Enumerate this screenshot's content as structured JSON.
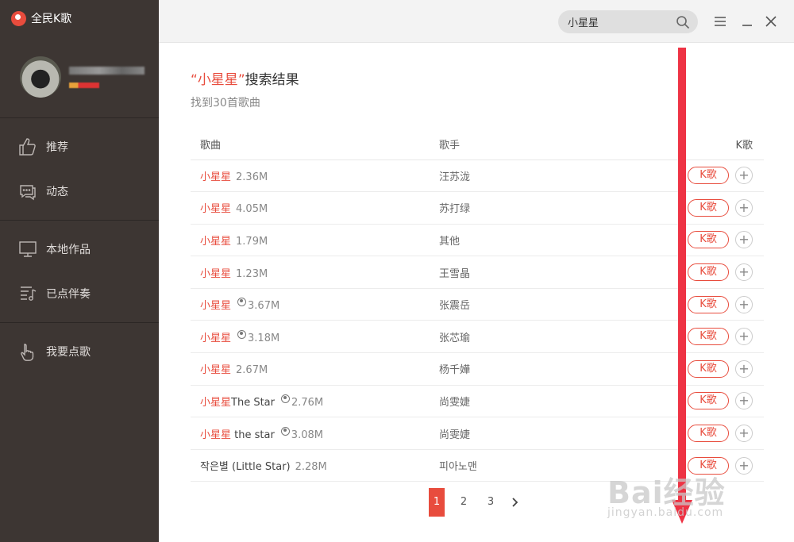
{
  "app": {
    "title": "全民K歌"
  },
  "search": {
    "value": "小星星"
  },
  "result": {
    "title_quote_open": "“",
    "keyword": "小星星",
    "title_quote_close": "”",
    "title_suffix": "搜索结果",
    "subtitle": "找到30首歌曲"
  },
  "nav": [
    {
      "label": "推荐",
      "icon": "thumbs-up-icon"
    },
    {
      "label": "动态",
      "icon": "chat-icon"
    },
    {
      "label": "本地作品",
      "icon": "monitor-icon"
    },
    {
      "label": "已点伴奏",
      "icon": "music-list-icon"
    },
    {
      "label": "我要点歌",
      "icon": "hand-select-icon"
    }
  ],
  "table": {
    "headers": {
      "song": "歌曲",
      "singer": "歌手",
      "k": "K歌"
    },
    "k_label": "K歌",
    "add_label": "+",
    "rows": [
      {
        "name": "小星星",
        "extra": "",
        "globe": false,
        "size": "2.36M",
        "singer": "汪苏泷",
        "plain": false
      },
      {
        "name": "小星星",
        "extra": "",
        "globe": false,
        "size": "4.05M",
        "singer": "苏打绿",
        "plain": false
      },
      {
        "name": "小星星",
        "extra": "",
        "globe": false,
        "size": "1.79M",
        "singer": "其他",
        "plain": false
      },
      {
        "name": "小星星",
        "extra": "",
        "globe": false,
        "size": "1.23M",
        "singer": "王雪晶",
        "plain": false
      },
      {
        "name": "小星星",
        "extra": "",
        "globe": true,
        "size": "3.67M",
        "singer": "张震岳",
        "plain": false
      },
      {
        "name": "小星星",
        "extra": "",
        "globe": true,
        "size": "3.18M",
        "singer": "张芯瑜",
        "plain": false
      },
      {
        "name": "小星星",
        "extra": "",
        "globe": false,
        "size": "2.67M",
        "singer": "杨千嬅",
        "plain": false
      },
      {
        "name": "小星星",
        "extra": "The Star",
        "globe": true,
        "size": "2.76M",
        "singer": "尚雯婕",
        "plain": false
      },
      {
        "name": "小星星",
        "extra": " the star",
        "globe": true,
        "size": "3.08M",
        "singer": "尚雯婕",
        "plain": false
      },
      {
        "name": "작은별 (Little Star)",
        "extra": "",
        "globe": false,
        "size": "2.28M",
        "singer": "피아노맨",
        "plain": true
      }
    ]
  },
  "pagination": {
    "pages": [
      "1",
      "2",
      "3"
    ],
    "active": "1"
  },
  "watermark": {
    "main": "Bai经验",
    "sub": "jingyan.baidu.com"
  },
  "colors": {
    "accent": "#e84c3d",
    "sidebar": "#3d3633",
    "arrow": "#ee3344"
  }
}
